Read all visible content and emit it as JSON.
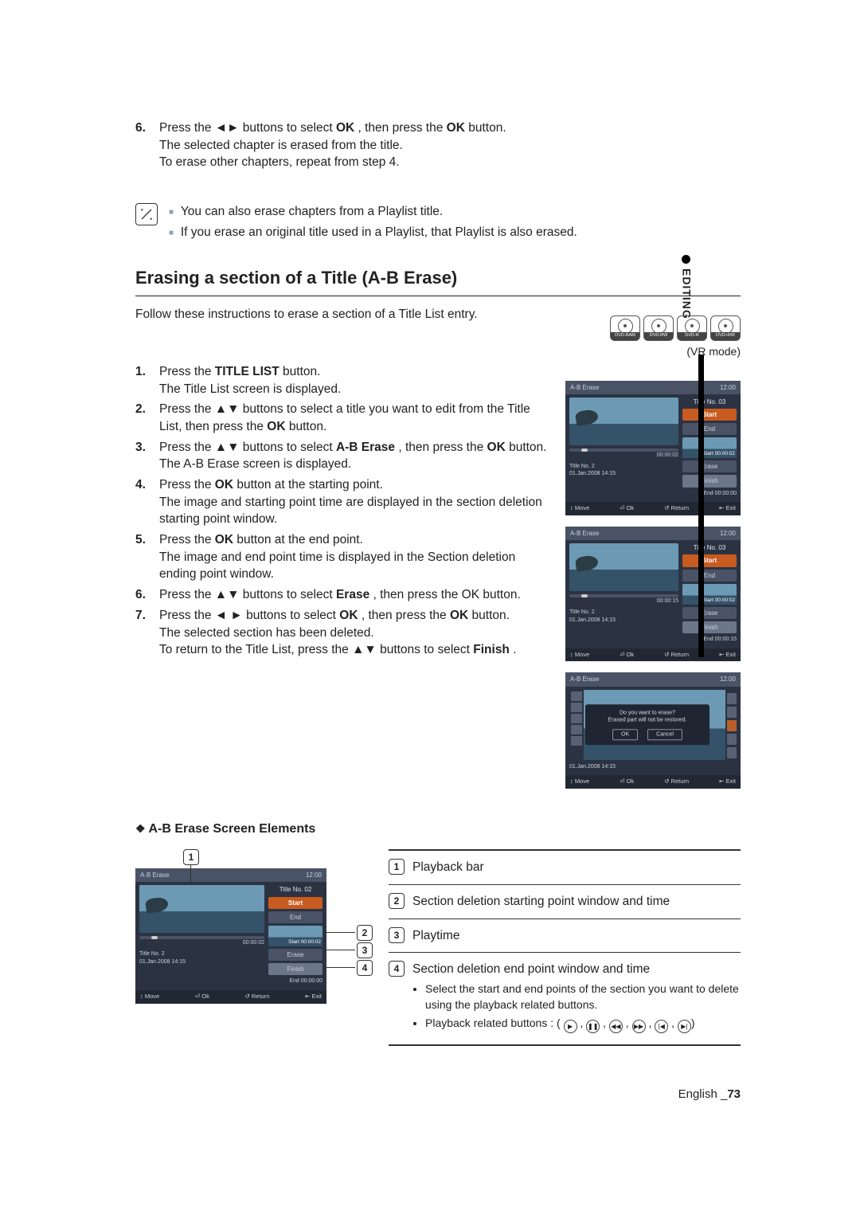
{
  "prev_steps": {
    "s6_a": "Press the ◄► buttons to select ",
    "s6_ok": "OK",
    "s6_b": ", then press the ",
    "s6_ok2": "OK",
    "s6_c": " button.",
    "s6_line2": "The selected chapter is erased from the title.",
    "s6_line3": "To erase other chapters, repeat from step 4."
  },
  "notes": {
    "n1": "You can also erase chapters from a Playlist title.",
    "n2": "If you erase an original title used in a Playlist, that Playlist is also erased."
  },
  "editing_tab": "EDITING",
  "section_heading": "Erasing a section of a Title (A-B Erase)",
  "intro": "Follow these instructions to erase a section of a Title List entry.",
  "discs": [
    "DVD-RAM",
    "DVD-RW",
    "DVD-R",
    "DVD+RW"
  ],
  "vrmode": "(VR mode)",
  "steps": {
    "s1_a": "Press the ",
    "s1_tl": "TITLE LIST",
    "s1_b": " button.",
    "s1_line2": "The Title List screen is displayed.",
    "s2_a": "Press the ▲▼ buttons to select a title you want to edit from the Title List, then press the ",
    "s2_ok": "OK",
    "s2_b": " button.",
    "s3_a": "Press the ▲▼ buttons to select ",
    "s3_ab": "A-B Erase",
    "s3_b": ", then press the ",
    "s3_ok": "OK",
    "s3_c": " button.",
    "s3_line2": "The A-B Erase screen is displayed.",
    "s4_a": "Press the ",
    "s4_ok": "OK",
    "s4_b": " button at the starting point.",
    "s4_line2": "The image and starting point time are displayed in the section deletion starting point window.",
    "s5_a": "Press the ",
    "s5_ok": "OK",
    "s5_b": " button at the end point.",
    "s5_line2": "The image and end point time is displayed in the Section deletion ending point window.",
    "s6_a": "Press the ▲▼ buttons to select ",
    "s6_er": "Erase",
    "s6_b": ", then press the OK button.",
    "s7_a": "Press the ◄ ► buttons to select ",
    "s7_ok": "OK",
    "s7_b": ", then press the ",
    "s7_ok2": "OK",
    "s7_c": " button.",
    "s7_line2": "The selected section has been deleted.",
    "s7_line3_a": "To return to the Title List, press the ▲▼ buttons to select ",
    "s7_fin": "Finish",
    "s7_line3_b": "."
  },
  "mock_common": {
    "title_label": "A-B Erase",
    "clock": "12:00",
    "title_no": "Title No. 03",
    "meta_line1": "Title No. 2",
    "meta_line2": "01.Jan.2008  14:15",
    "f_move": "↕ Move",
    "f_ok": "⏎ Ok",
    "f_return": "↺ Return",
    "f_exit": "⇤ Exit"
  },
  "mock1": {
    "pb_time": "00:00:02",
    "start_lbl": "Start 00:00:02",
    "end_lbl": "End 00:00:00",
    "buttons": [
      {
        "label": "Start",
        "sel": true
      },
      {
        "label": "End",
        "sel": false
      },
      {
        "label": "Erase",
        "sel": false
      },
      {
        "label": "Finish",
        "sel": false
      }
    ]
  },
  "mock2": {
    "pb_time": "00:00:15",
    "start_lbl": "Start 00:00:02",
    "end_lbl": "End 00:00:15",
    "buttons": [
      {
        "label": "Start",
        "sel": true
      },
      {
        "label": "End",
        "sel": false
      },
      {
        "label": "Erase",
        "sel": false
      },
      {
        "label": "Finish",
        "sel": false
      }
    ]
  },
  "mock3": {
    "dlg_line1": "Do you want to erase?",
    "dlg_line2": "Erased part will not be restored.",
    "dlg_ok": "OK",
    "dlg_cancel": "Cancel"
  },
  "subheading": "A-B Erase Screen Elements",
  "legend": {
    "l1": "Playback bar",
    "l2": "Section deletion starting point window and time",
    "l3": "Playtime",
    "l4_header": "Section deletion end point window and time",
    "l4_b1": "Select the start and end points of the section you want to delete using the playback related buttons.",
    "l4_b2": "Playback related buttons : ("
  },
  "footer": {
    "english": "English",
    "pg": "73"
  }
}
